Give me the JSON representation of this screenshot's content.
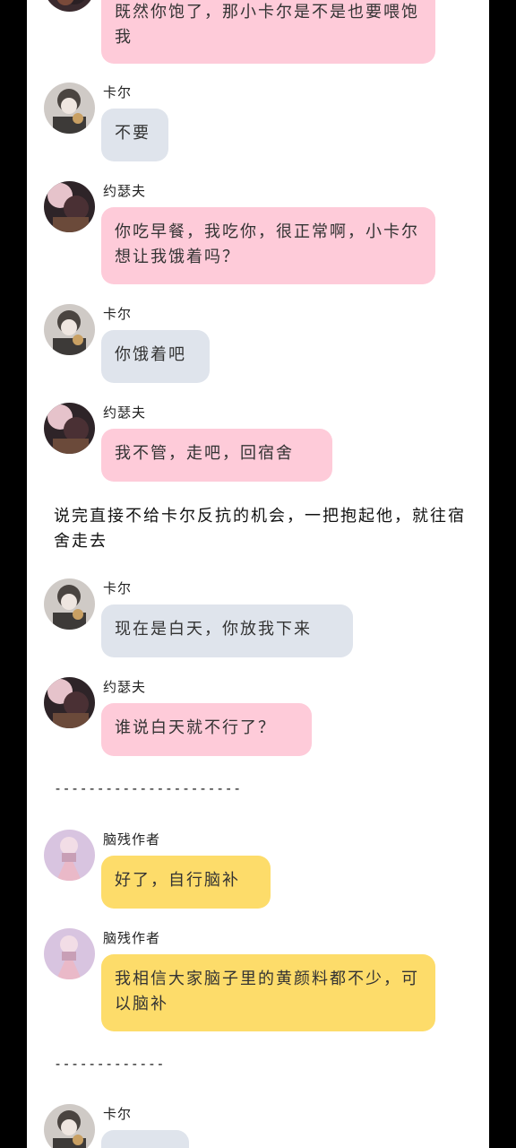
{
  "characters": {
    "karl": {
      "name": "卡尔",
      "avatar_icon": "karl-avatar-icon"
    },
    "joseph": {
      "name": "约瑟夫",
      "avatar_icon": "joseph-avatar-icon"
    },
    "author": {
      "name": "脑残作者",
      "avatar_icon": "author-avatar-icon"
    }
  },
  "messages": [
    {
      "sender": "",
      "text": "既然你饱了，那小卡尔是不是也要喂饱我",
      "style": "pink"
    },
    {
      "sender": "卡尔",
      "text": "不要",
      "style": "gray"
    },
    {
      "sender": "约瑟夫",
      "text": "你吃早餐，我吃你，很正常啊，小卡尔想让我饿着吗？",
      "style": "pink"
    },
    {
      "sender": "卡尔",
      "text": "你饿着吧",
      "style": "gray"
    },
    {
      "sender": "约瑟夫",
      "text": "我不管，走吧，回宿舍",
      "style": "pink"
    },
    {
      "sender": "卡尔",
      "text": "现在是白天，你放我下来",
      "style": "gray"
    },
    {
      "sender": "约瑟夫",
      "text": "谁说白天就不行了？",
      "style": "pink"
    },
    {
      "sender": "脑残作者",
      "text": "好了，自行脑补",
      "style": "yellow"
    },
    {
      "sender": "脑残作者",
      "text": "我相信大家脑子里的黄颜料都不少，可以脑补",
      "style": "yellow"
    },
    {
      "sender": "卡尔",
      "text": "",
      "style": "gray"
    }
  ],
  "narration": "说完直接不给卡尔反抗的机会，一把抱起他，就往宿舍走去",
  "dividers": [
    "----------------------",
    "-------------"
  ],
  "colors": {
    "pink_bubble": "#fecbd9",
    "gray_bubble": "#dfe4ec",
    "yellow_bubble": "#fddc6a"
  }
}
